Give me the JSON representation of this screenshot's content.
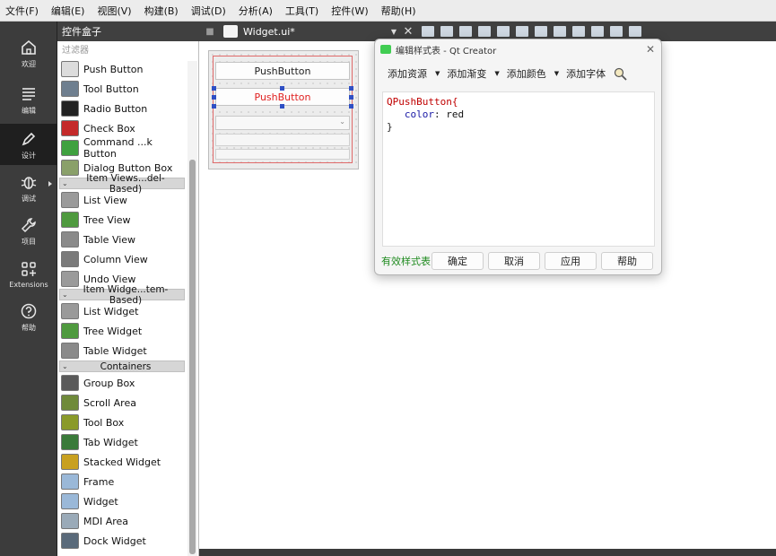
{
  "menubar": [
    "文件(F)",
    "编辑(E)",
    "视图(V)",
    "构建(B)",
    "调试(D)",
    "分析(A)",
    "工具(T)",
    "控件(W)",
    "帮助(H)"
  ],
  "modes": [
    {
      "label": "欢迎",
      "icon": "home-icon"
    },
    {
      "label": "编辑",
      "icon": "edit-lines-icon"
    },
    {
      "label": "设计",
      "icon": "design-pen-icon",
      "active": true
    },
    {
      "label": "调试",
      "icon": "debug-bug-icon"
    },
    {
      "label": "项目",
      "icon": "wrench-icon"
    },
    {
      "label": "Extensions",
      "icon": "extensions-grid-icon"
    },
    {
      "label": "帮助",
      "icon": "help-question-icon"
    }
  ],
  "widget_box": {
    "title": "控件盒子",
    "filter_placeholder": "过滤器",
    "entries": [
      {
        "kind": "item",
        "label": "Push Button",
        "icon": "push-button-icon",
        "color": "#dcdcdc"
      },
      {
        "kind": "item",
        "label": "Tool Button",
        "icon": "tool-button-icon",
        "color": "#6f7f8f"
      },
      {
        "kind": "item",
        "label": "Radio Button",
        "icon": "radio-button-icon",
        "color": "#222222"
      },
      {
        "kind": "item",
        "label": "Check Box",
        "icon": "check-box-icon",
        "color": "#c42a2a"
      },
      {
        "kind": "item",
        "label": "Command ...k Button",
        "icon": "command-link-icon",
        "color": "#3fa13f"
      },
      {
        "kind": "item",
        "label": "Dialog Button Box",
        "icon": "dialog-button-box-icon",
        "color": "#8aa06a"
      },
      {
        "kind": "category",
        "label": "Item Views...del-Based)"
      },
      {
        "kind": "item",
        "label": "List View",
        "icon": "list-view-icon",
        "color": "#9a9a9a"
      },
      {
        "kind": "item",
        "label": "Tree View",
        "icon": "tree-view-icon",
        "color": "#4f9a3f"
      },
      {
        "kind": "item",
        "label": "Table View",
        "icon": "table-view-icon",
        "color": "#8a8a8a"
      },
      {
        "kind": "item",
        "label": "Column View",
        "icon": "column-view-icon",
        "color": "#7a7a7a"
      },
      {
        "kind": "item",
        "label": "Undo View",
        "icon": "undo-view-icon",
        "color": "#9a9a9a"
      },
      {
        "kind": "category",
        "label": "Item Widge...tem-Based)"
      },
      {
        "kind": "item",
        "label": "List Widget",
        "icon": "list-widget-icon",
        "color": "#9a9a9a"
      },
      {
        "kind": "item",
        "label": "Tree Widget",
        "icon": "tree-widget-icon",
        "color": "#4f9a3f"
      },
      {
        "kind": "item",
        "label": "Table Widget",
        "icon": "table-widget-icon",
        "color": "#8a8a8a"
      },
      {
        "kind": "category",
        "label": "Containers"
      },
      {
        "kind": "item",
        "label": "Group Box",
        "icon": "group-box-icon",
        "color": "#5a5a5a"
      },
      {
        "kind": "item",
        "label": "Scroll Area",
        "icon": "scroll-area-icon",
        "color": "#6f8a3a"
      },
      {
        "kind": "item",
        "label": "Tool Box",
        "icon": "tool-box-icon",
        "color": "#8a9a2a"
      },
      {
        "kind": "item",
        "label": "Tab Widget",
        "icon": "tab-widget-icon",
        "color": "#3a7a3a"
      },
      {
        "kind": "item",
        "label": "Stacked Widget",
        "icon": "stacked-widget-icon",
        "color": "#c8a020"
      },
      {
        "kind": "item",
        "label": "Frame",
        "icon": "frame-icon",
        "color": "#9ab8d8"
      },
      {
        "kind": "item",
        "label": "Widget",
        "icon": "widget-icon",
        "color": "#9ab8d8"
      },
      {
        "kind": "item",
        "label": "MDI Area",
        "icon": "mdi-area-icon",
        "color": "#9aaab8"
      },
      {
        "kind": "item",
        "label": "Dock Widget",
        "icon": "dock-widget-icon",
        "color": "#5a6a7a"
      }
    ]
  },
  "editor": {
    "file_name": "Widget.ui*",
    "form": {
      "button1": "PushButton",
      "button2": "PushButton",
      "button2_color": "#e02020"
    }
  },
  "dialog": {
    "title": "编辑样式表 - Qt Creator",
    "toolbar": [
      "添加资源",
      "添加渐变",
      "添加颜色",
      "添加字体"
    ],
    "code": {
      "line1": "QPushButton{",
      "prop": "color",
      "value": "red",
      "line3": "}"
    },
    "status": "有效样式表",
    "buttons": [
      "确定",
      "取消",
      "应用",
      "帮助"
    ]
  }
}
